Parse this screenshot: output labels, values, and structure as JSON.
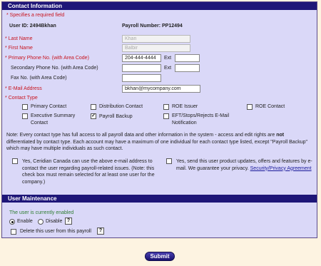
{
  "contact": {
    "header": "Contact Information",
    "required_note": "* Specifies a required field",
    "user_id": "User ID: 2494Bkhan",
    "payroll_number": "Payroll Number: PP12494",
    "last_name_label": "Last Name",
    "last_name_value": "Khan",
    "first_name_label": "First Name",
    "first_name_value": "Balbir",
    "primary_phone_label": "Primary Phone No. (with Area Code)",
    "primary_phone_value": "204-444-4444",
    "ext_label": "Ext",
    "secondary_phone_label": "Secondary Phone No. (with Area Code)",
    "fax_label": "Fax No. (with Area Code)",
    "email_label": "E-Mail Address",
    "email_value": "bkhan@mycompany.com",
    "contact_type_label": "Contact Type",
    "types": {
      "primary": "Primary Contact",
      "distribution": "Distribution Contact",
      "roe_issuer": "ROE Issuer",
      "roe_contact": "ROE Contact",
      "exec_summary": "Executive Summary Contact",
      "payroll_backup": "Payroll Backup",
      "eft": "EFT/Stops/Rejects E-Mail Notification"
    },
    "note_pre": "Note: Every contact type has full access to all payroll data and other information in the system - access and edit rights are ",
    "note_bold": "not",
    "note_post": " differentiated by contact type. Each account may have a maximum of one individual for each contact type listed, except \"Payroll Backup\" which may have multiple individuals as such contact.",
    "consent_left": "Yes, Ceridian Canada can use the above e-mail address to contact the user regarding payroll-related issues. (Note: this check box must remain selected for at least one user for the company.)",
    "consent_right": "Yes, send this user product updates, offers and features by e-mail. We guarantee your privacy.",
    "privacy_link": "Security/Privacy Agreement"
  },
  "maintenance": {
    "header": "User Maintenance",
    "status": "The user is currently enabled",
    "enable": "Enable",
    "disable": "Disable",
    "delete": "Delete this user from this payroll",
    "help": "?"
  },
  "submit_label": "Submit",
  "colors": {
    "header_bg": "#1e1678",
    "panel_bg": "#dad8f8",
    "page_bg": "#fdf3e1",
    "required": "#c8141e",
    "enabled": "#2e7d32"
  }
}
